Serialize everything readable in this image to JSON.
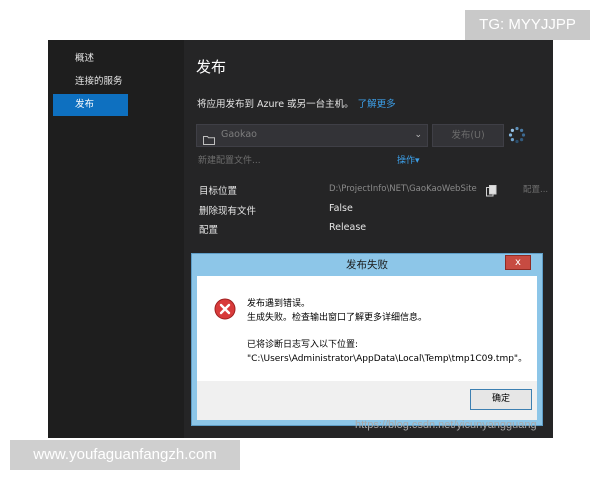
{
  "watermarks": {
    "top": "TG: MYYJJPP",
    "bottom": "www.youfaguanfangzh.com",
    "blog": "https://blog.csdn.net/yicunyangguang"
  },
  "sidebar": {
    "items": [
      {
        "label": "概述",
        "active": false
      },
      {
        "label": "连接的服务",
        "active": false
      },
      {
        "label": "发布",
        "active": true
      }
    ]
  },
  "main": {
    "title": "发布",
    "description": "将应用发布到 Azure 或另一台主机。",
    "learn_more": "了解更多",
    "profile_select": {
      "value": "Gaokao",
      "icon": "folder-icon"
    },
    "publish_button": "发布(U)",
    "new_profile": "新建配置文件...",
    "actions": "操作▾",
    "properties": [
      {
        "label": "目标位置",
        "value": "D:\\ProjectInfo\\NET\\GaoKaoWebSite"
      },
      {
        "label": "删除现有文件",
        "value": "False"
      },
      {
        "label": "配置",
        "value": "Release"
      }
    ],
    "config_link": "配置..."
  },
  "dialog": {
    "title": "发布失败",
    "close": "x",
    "icon": "error-icon",
    "lines": [
      "发布遇到错误。",
      "生成失败。检查输出窗口了解更多详细信息。",
      "已将诊断日志写入以下位置:",
      "\"C:\\Users\\Administrator\\AppData\\Local\\Temp\\tmp1C09.tmp\"。"
    ],
    "ok_button": "确定"
  },
  "colors": {
    "vs_background": "#252526",
    "sidebar_background": "#1e1e1e",
    "accent": "#0e70c0",
    "link": "#3c9fe8",
    "dialog_frame": "#8dc6e8",
    "error_red": "#d83b3b"
  }
}
